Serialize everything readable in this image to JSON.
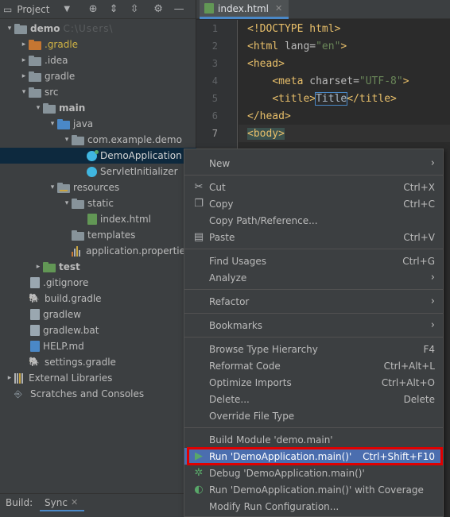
{
  "project_panel": {
    "title": "Project",
    "tree": [
      {
        "label": "demo",
        "depth": 0,
        "arrow": "▾",
        "icon": "folder",
        "bold": true,
        "blur": "C:\\Users\\"
      },
      {
        "label": ".gradle",
        "depth": 1,
        "arrow": "▸",
        "icon": "folder-orange",
        "style": "orange"
      },
      {
        "label": ".idea",
        "depth": 1,
        "arrow": "▸",
        "icon": "folder"
      },
      {
        "label": "gradle",
        "depth": 1,
        "arrow": "▸",
        "icon": "folder"
      },
      {
        "label": "src",
        "depth": 1,
        "arrow": "▾",
        "icon": "folder"
      },
      {
        "label": "main",
        "depth": 2,
        "arrow": "▾",
        "icon": "folder",
        "bold": true
      },
      {
        "label": "java",
        "depth": 3,
        "arrow": "▾",
        "icon": "folder-blue"
      },
      {
        "label": "com.example.demo",
        "depth": 4,
        "arrow": "▾",
        "icon": "folder"
      },
      {
        "label": "DemoApplication",
        "depth": 5,
        "arrow": "",
        "icon": "class-run",
        "selected": true,
        "style": "white"
      },
      {
        "label": "ServletInitializer",
        "depth": 5,
        "arrow": "",
        "icon": "class"
      },
      {
        "label": "resources",
        "depth": 3,
        "arrow": "▾",
        "icon": "folder-res"
      },
      {
        "label": "static",
        "depth": 4,
        "arrow": "▾",
        "icon": "folder"
      },
      {
        "label": "index.html",
        "depth": 5,
        "arrow": "",
        "icon": "file-html"
      },
      {
        "label": "templates",
        "depth": 4,
        "arrow": "",
        "icon": "folder"
      },
      {
        "label": "application.properties",
        "depth": 4,
        "arrow": "",
        "icon": "properties"
      },
      {
        "label": "test",
        "depth": 2,
        "arrow": "▸",
        "icon": "folder-green",
        "bold": true
      },
      {
        "label": ".gitignore",
        "depth": 1,
        "arrow": "",
        "icon": "file"
      },
      {
        "label": "build.gradle",
        "depth": 1,
        "arrow": "",
        "icon": "gradle"
      },
      {
        "label": "gradlew",
        "depth": 1,
        "arrow": "",
        "icon": "file"
      },
      {
        "label": "gradlew.bat",
        "depth": 1,
        "arrow": "",
        "icon": "file"
      },
      {
        "label": "HELP.md",
        "depth": 1,
        "arrow": "",
        "icon": "file-md"
      },
      {
        "label": "settings.gradle",
        "depth": 1,
        "arrow": "",
        "icon": "gradle"
      },
      {
        "label": "External Libraries",
        "depth": 0,
        "arrow": "▸",
        "icon": "libraries"
      },
      {
        "label": "Scratches and Consoles",
        "depth": 0,
        "arrow": "",
        "icon": "scratches"
      }
    ]
  },
  "editor": {
    "tab_label": "index.html",
    "lines": [
      {
        "num": "1",
        "parts": [
          {
            "t": "<!DOCTYPE html>",
            "c": "c-tag"
          }
        ]
      },
      {
        "num": "2",
        "parts": [
          {
            "t": "<html ",
            "c": "c-tag"
          },
          {
            "t": "lang=",
            "c": "c-attr"
          },
          {
            "t": "\"en\"",
            "c": "c-str"
          },
          {
            "t": ">",
            "c": "c-tag"
          }
        ]
      },
      {
        "num": "3",
        "parts": [
          {
            "t": "<head>",
            "c": "c-tag"
          }
        ]
      },
      {
        "num": "4",
        "parts": [
          {
            "t": "    ",
            "c": "c-txt"
          },
          {
            "t": "<meta ",
            "c": "c-tag"
          },
          {
            "t": "charset=",
            "c": "c-attr"
          },
          {
            "t": "\"UTF-8\"",
            "c": "c-str"
          },
          {
            "t": ">",
            "c": "c-tag"
          }
        ]
      },
      {
        "num": "5",
        "parts": [
          {
            "t": "    ",
            "c": "c-txt"
          },
          {
            "t": "<title>",
            "c": "c-tag"
          },
          {
            "t": "Title",
            "c": "c-box"
          },
          {
            "t": "</title>",
            "c": "c-tag"
          }
        ]
      },
      {
        "num": "6",
        "parts": [
          {
            "t": "</head>",
            "c": "c-tag"
          }
        ]
      },
      {
        "num": "7",
        "current": true,
        "parts": [
          {
            "t": "<body>",
            "c": "c-body"
          }
        ]
      }
    ]
  },
  "context_menu": {
    "items": [
      {
        "label": "New",
        "submenu": true
      },
      {
        "sep": true
      },
      {
        "label": "Cut",
        "key": "Ctrl+X",
        "icon": "scissors-icon"
      },
      {
        "label": "Copy",
        "key": "Ctrl+C",
        "icon": "copy-icon"
      },
      {
        "label": "Copy Path/Reference..."
      },
      {
        "label": "Paste",
        "key": "Ctrl+V",
        "icon": "paste-icon"
      },
      {
        "sep": true
      },
      {
        "label": "Find Usages",
        "key": "Ctrl+G"
      },
      {
        "label": "Analyze",
        "submenu": true
      },
      {
        "sep": true
      },
      {
        "label": "Refactor",
        "submenu": true
      },
      {
        "sep": true
      },
      {
        "label": "Bookmarks",
        "submenu": true
      },
      {
        "sep": true
      },
      {
        "label": "Browse Type Hierarchy",
        "key": "F4"
      },
      {
        "label": "Reformat Code",
        "key": "Ctrl+Alt+L"
      },
      {
        "label": "Optimize Imports",
        "key": "Ctrl+Alt+O"
      },
      {
        "label": "Delete...",
        "key": "Delete"
      },
      {
        "label": "Override File Type"
      },
      {
        "sep": true
      },
      {
        "label": "Build Module 'demo.main'"
      },
      {
        "label": "Run 'DemoApplication.main()'",
        "key": "Ctrl+Shift+F10",
        "icon": "run-icon",
        "highlight": true
      },
      {
        "label": "Debug 'DemoApplication.main()'",
        "icon": "debug-icon"
      },
      {
        "label": "Run 'DemoApplication.main()' with Coverage",
        "icon": "coverage-icon"
      },
      {
        "label": "Modify Run Configuration..."
      }
    ]
  },
  "bottom_bar": {
    "build_label": "Build:",
    "sync_label": "Sync"
  },
  "colors": {
    "accent": "#4b6eaf",
    "highlight_box": "#e00000"
  }
}
